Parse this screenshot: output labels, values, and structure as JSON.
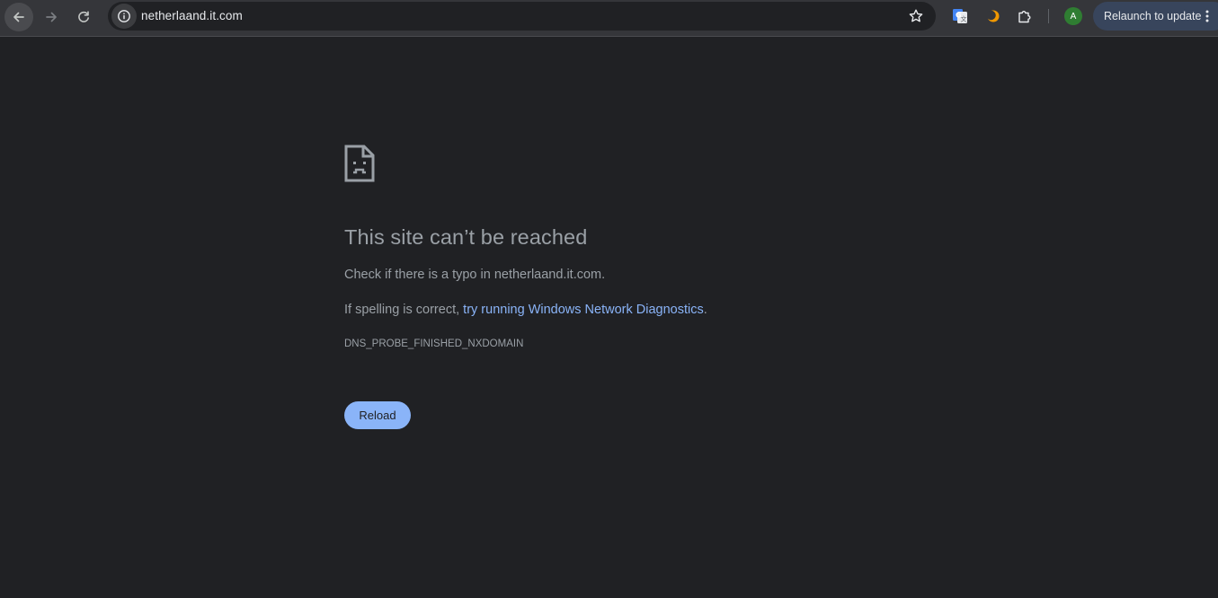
{
  "toolbar": {
    "url": "netherlaand.it.com",
    "profile_initial": "A",
    "relaunch_label": "Relaunch to update"
  },
  "error": {
    "title": "This site can’t be reached",
    "message_typo": "Check if there is a typo in netherlaand.it.com.",
    "message_spelling_prefix": "If spelling is correct, ",
    "message_spelling_link": "try running Windows Network Diagnostics",
    "message_spelling_suffix": ".",
    "code": "DNS_PROBE_FINISHED_NXDOMAIN",
    "reload_label": "Reload"
  },
  "colors": {
    "page_background": "#202124",
    "toolbar_background": "#35363a",
    "link": "#8ab4f8",
    "text_secondary": "#9aa0a6",
    "button_primary": "#8ab4f8",
    "relaunch_chip": "#38455c",
    "avatar": "#2f7d32"
  },
  "icons": {
    "back": "arrow-left-icon",
    "forward": "arrow-right-icon",
    "reload": "reload-icon",
    "site_info": "info-icon",
    "bookmark": "star-icon",
    "translate_extension": "google-translate-icon",
    "orange_extension": "orange-crescent-icon",
    "extensions": "puzzle-icon",
    "menu": "kebab-menu-icon",
    "error": "sad-page-icon"
  }
}
